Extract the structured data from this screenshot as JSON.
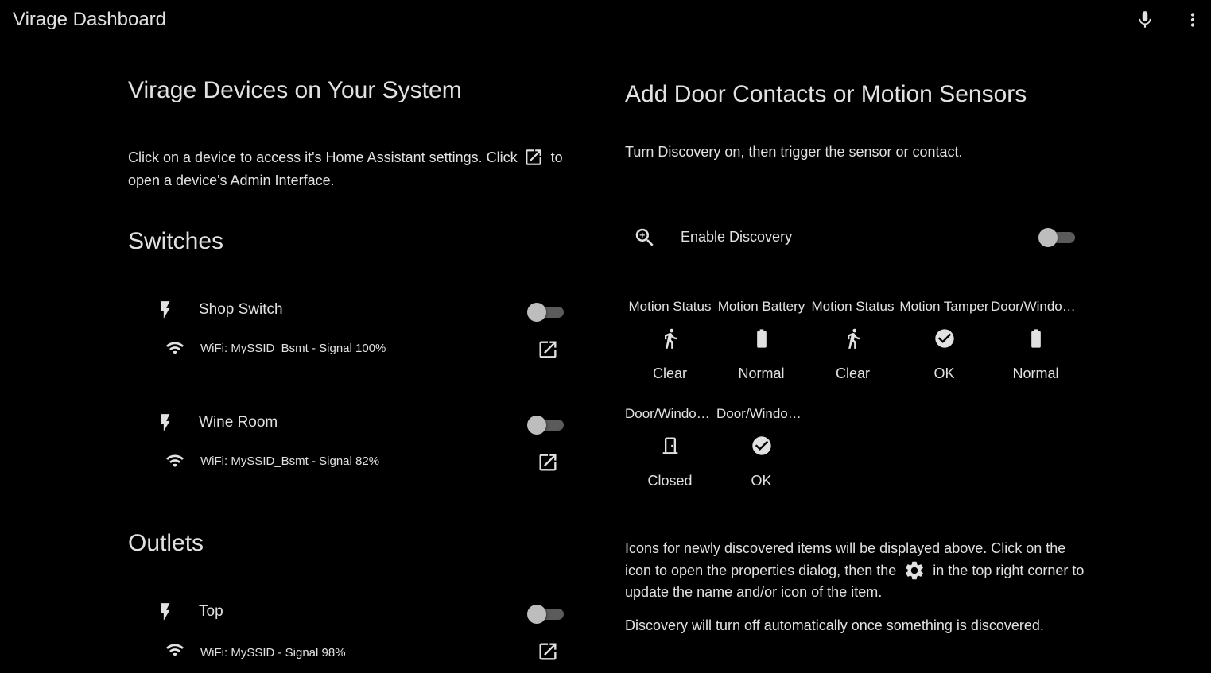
{
  "app": {
    "title": "Virage Dashboard",
    "icons": {
      "mic": "microphone-icon",
      "menu": "more-vert-icon"
    }
  },
  "left": {
    "title": "Virage Devices on Your System",
    "description_part1": "Click on a device to access it's Home Assistant settings. Click",
    "description_part2": "to open a device's Admin Interface.",
    "sections": [
      {
        "title": "Switches",
        "devices": [
          {
            "name": "Shop Switch",
            "wifi": "WiFi: MySSID_Bsmt - Signal 100%",
            "on": false
          },
          {
            "name": "Wine Room",
            "wifi": "WiFi: MySSID_Bsmt - Signal 82%",
            "on": false
          }
        ]
      },
      {
        "title": "Outlets",
        "devices": [
          {
            "name": "Top",
            "wifi": "WiFi: MySSID - Signal 98%",
            "on": false
          }
        ]
      }
    ]
  },
  "right": {
    "title": "Add Door Contacts or Motion Sensors",
    "subtitle": "Turn Discovery on, then trigger the sensor or contact.",
    "discovery": {
      "label": "Enable Discovery",
      "icon": "magnify-plus-icon",
      "on": false
    },
    "entities": [
      {
        "name": "Motion Status",
        "icon": "walk-icon",
        "state": "Clear"
      },
      {
        "name": "Motion Battery",
        "icon": "battery-icon",
        "state": "Normal"
      },
      {
        "name": "Motion Status",
        "icon": "walk-icon",
        "state": "Clear"
      },
      {
        "name": "Motion Tamper",
        "icon": "check-circle-icon",
        "state": "OK"
      },
      {
        "name": "Door/Window Battery",
        "icon": "battery-icon",
        "state": "Normal"
      },
      {
        "name": "Door/Window Status",
        "icon": "door-closed-icon",
        "state": "Closed"
      },
      {
        "name": "Door/Window Tamper",
        "icon": "check-circle-icon",
        "state": "OK"
      }
    ],
    "note1_part1": "Icons for newly discovered items will be displayed above. Click on the icon to open the properties dialog, then the",
    "note1_part2": "in the top right corner to update the name and/or icon of the item.",
    "note2": "Discovery will turn off automatically once something is discovered."
  }
}
